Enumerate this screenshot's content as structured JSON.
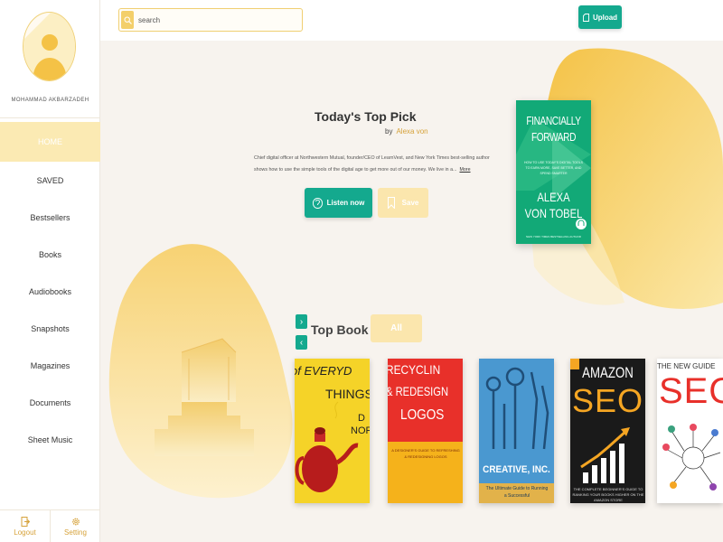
{
  "user": {
    "name": "MOHAMMAD AKBARZADEH"
  },
  "sidebar": {
    "items": [
      {
        "label": "HOME",
        "active": true
      },
      {
        "label": "SAVED"
      },
      {
        "label": "Bestsellers"
      },
      {
        "label": "Books"
      },
      {
        "label": "Audiobooks"
      },
      {
        "label": "Snapshots"
      },
      {
        "label": "Magazines"
      },
      {
        "label": "Documents"
      },
      {
        "label": "Sheet Music"
      }
    ],
    "footer": {
      "logout": "Logout",
      "setting": "Setting"
    }
  },
  "topbar": {
    "search_placeholder": "search",
    "upload_label": "Upload"
  },
  "top_pick": {
    "title": "Today's Top Pick",
    "by": "by",
    "author": "Alexa von",
    "description": "Chief digital officer at Northwestern Mutual, founder/CEO of LearnVest, and New York Times best-selling author shows how to use the simple tools of the digital age to get more out of our money. We live in a...",
    "more": "More",
    "listen_label": "Listen now",
    "save_label": "Save",
    "cover": {
      "title_line1": "FINANCIALLY",
      "title_line2": "FORWARD",
      "subtitle": "HOW TO USE TODAY'S DIGITAL TOOLS TO EARN MORE, SAVE BETTER, AND SPEND SMARTER",
      "author_line1": "ALEXA",
      "author_line2": "VON TOBEL",
      "foot": "NEW YORK TIMES BESTSELLING AUTHOR"
    }
  },
  "top_book": {
    "title": "Top Book",
    "all_label": "All",
    "books": [
      {
        "line1": "of EVERYD",
        "line2": "THINGS",
        "line3": "D",
        "line4": "NOR"
      },
      {
        "line1": "RECYCLIN",
        "line2": "& REDESIGN",
        "line3": "LOGOS",
        "sub": "A DESIGNER'S GUIDE TO REFRESHING & REDESIGNING LOGOS"
      },
      {
        "line1": "CREATIVE, INC.",
        "sub": "The Ultimate Guide to Running a Successful"
      },
      {
        "line1": "AMAZON",
        "line2": "SEO",
        "sub": "THE COMPLETE BEGINNER'S GUIDE TO RANKING YOUR BOOKS HIGHER ON THE AMAZON STORE"
      },
      {
        "line1": "THE NEW GUIDE",
        "line2": "SEO"
      }
    ]
  },
  "colors": {
    "accent_green": "#14a98e",
    "accent_gold": "#f0c550",
    "soft_gold": "#fbe6ad"
  }
}
